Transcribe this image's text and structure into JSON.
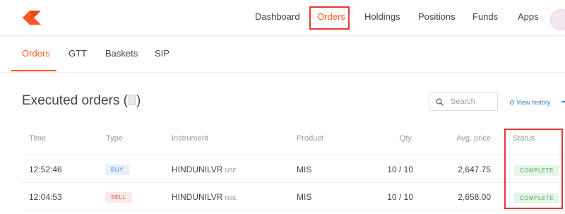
{
  "app": {
    "nav": [
      {
        "label": "Dashboard"
      },
      {
        "label": "Orders"
      },
      {
        "label": "Holdings"
      },
      {
        "label": "Positions"
      },
      {
        "label": "Funds"
      },
      {
        "label": "Apps"
      }
    ]
  },
  "subtabs": [
    {
      "label": "Orders"
    },
    {
      "label": "GTT"
    },
    {
      "label": "Baskets"
    },
    {
      "label": "SIP"
    }
  ],
  "section": {
    "title": "Executed orders (",
    "title_end": ")",
    "search_placeholder": "Search",
    "view_history": "View history"
  },
  "table": {
    "headers": {
      "time": "Time",
      "type": "Type",
      "instrument": "Instrument",
      "product": "Product",
      "qty": "Qty.",
      "avg_price": "Avg. price",
      "status": "Status"
    },
    "rows": [
      {
        "time": "12:52:46",
        "type": "BUY",
        "instrument": "HINDUNILVR",
        "exchange": "NSE",
        "product": "MIS",
        "qty": "10 / 10",
        "avg_price": "2,647.75",
        "status": "COMPLETE"
      },
      {
        "time": "12:04:53",
        "type": "SELL",
        "instrument": "HINDUNILVR",
        "exchange": "NSE",
        "product": "MIS",
        "qty": "10 / 10",
        "avg_price": "2,658.00",
        "status": "COMPLETE"
      }
    ]
  },
  "colors": {
    "accent": "#ff5722",
    "link": "#387ed1",
    "highlight": "#e53935",
    "buy": "#4184f3",
    "sell": "#e5533c",
    "complete": "#4caf50"
  },
  "icons": [
    "kite-logo",
    "search-icon",
    "history-icon",
    "avatar"
  ]
}
